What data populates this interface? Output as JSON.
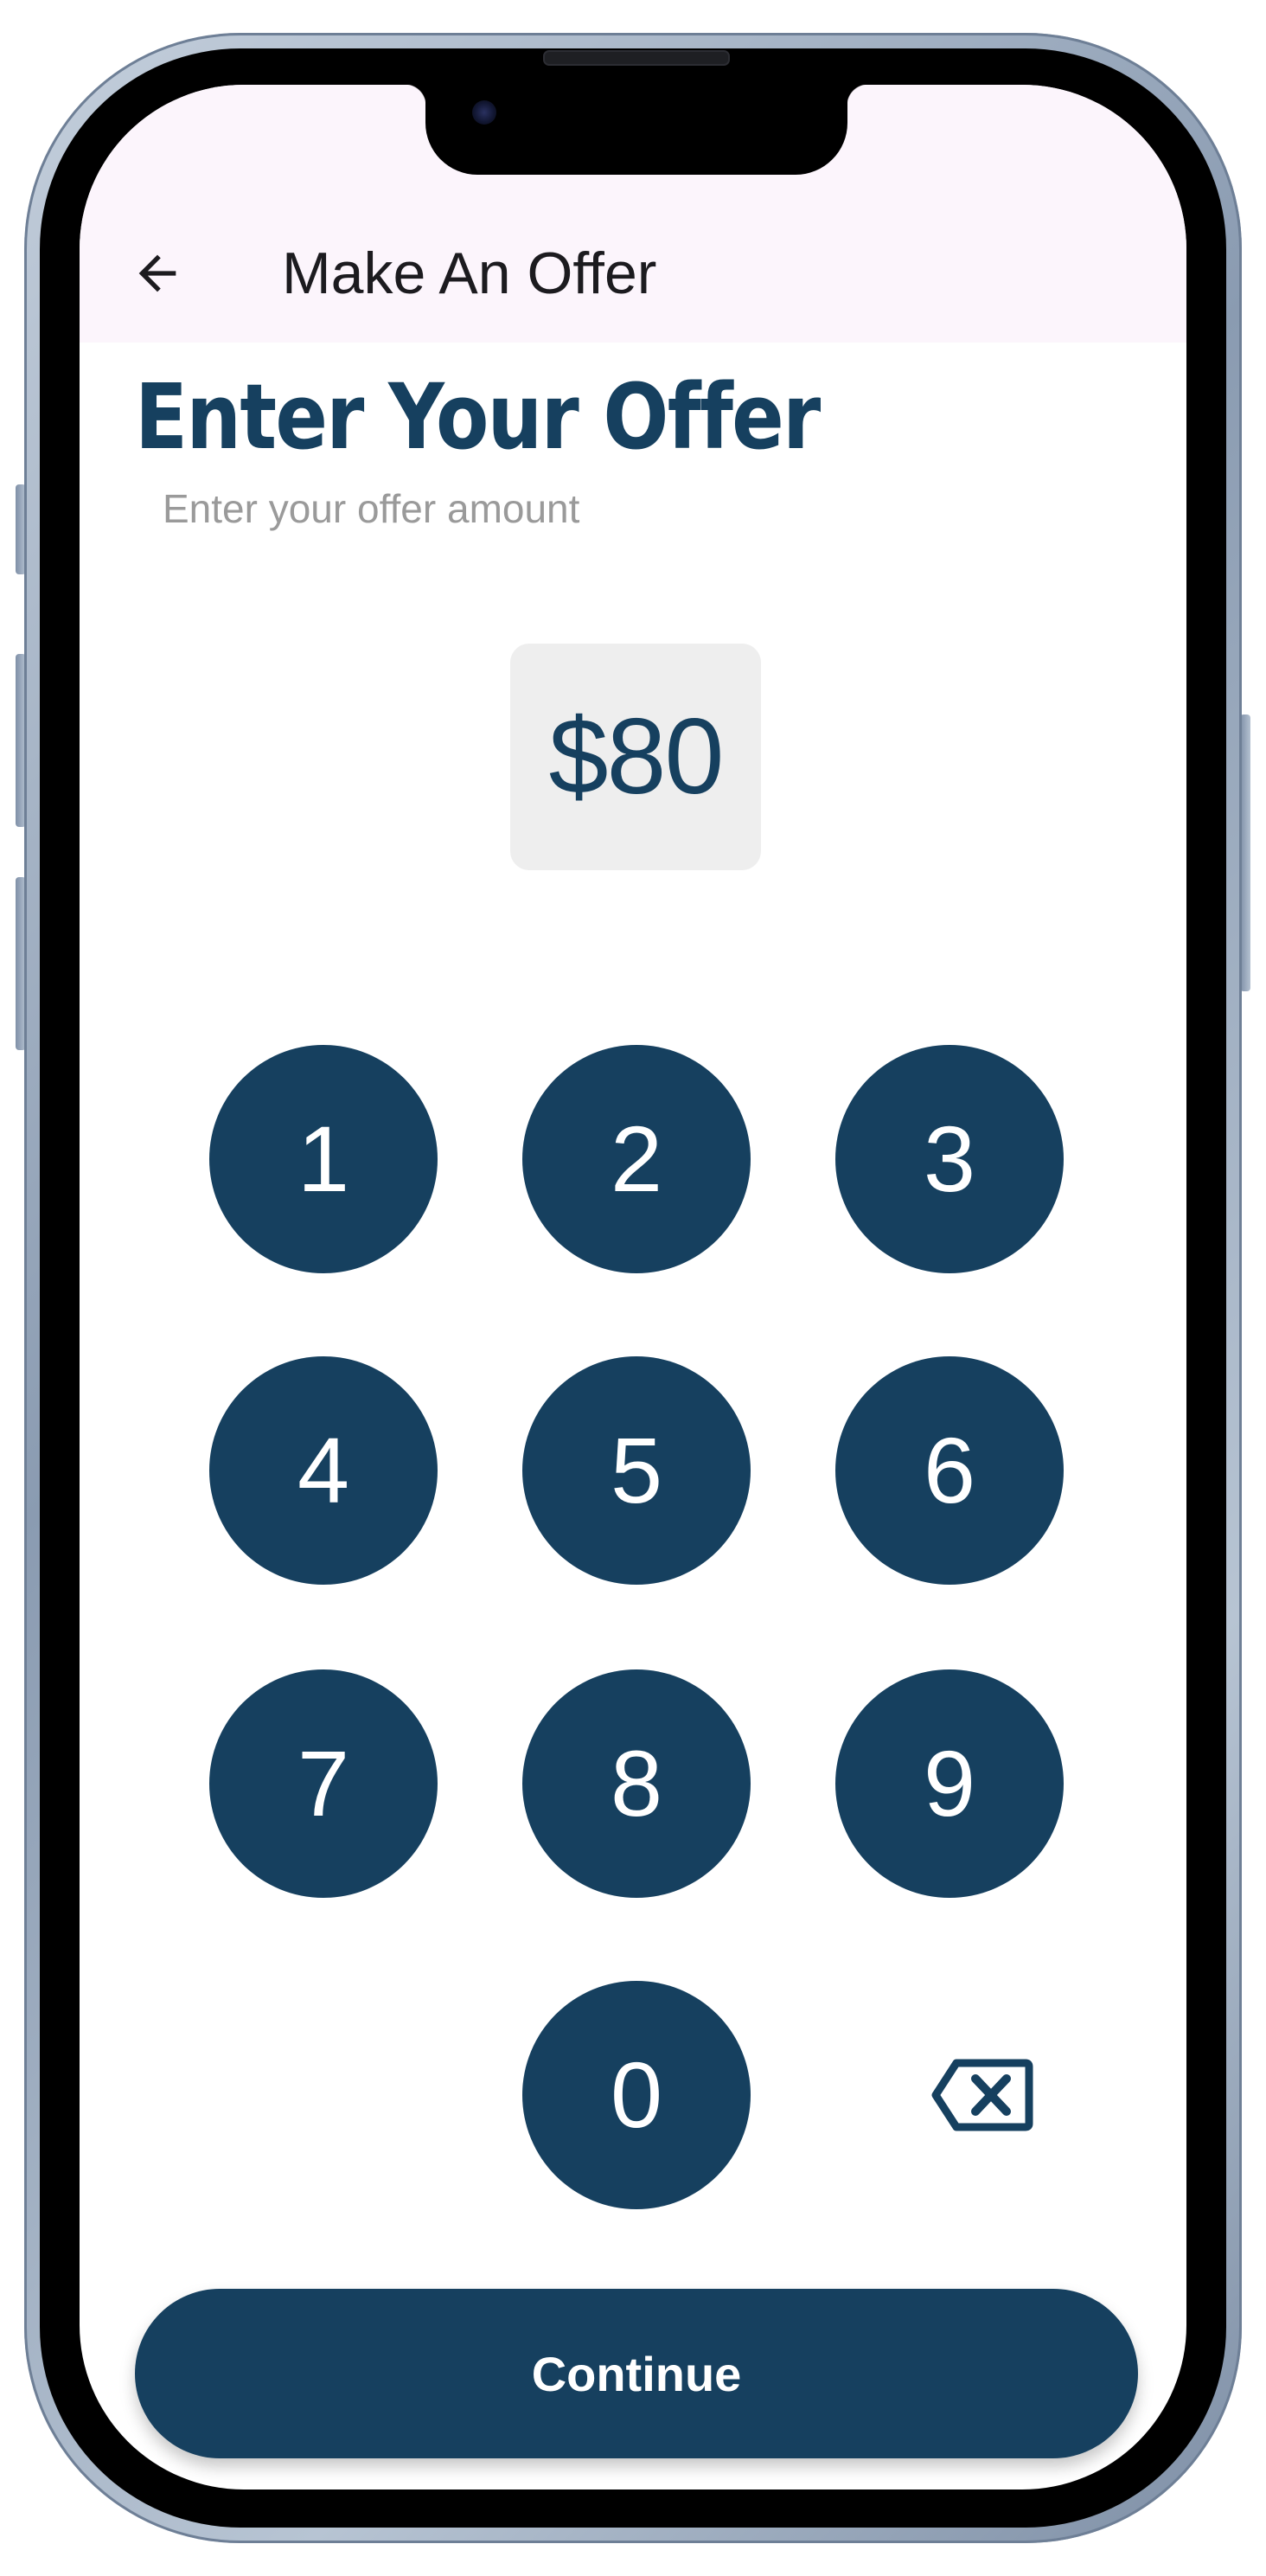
{
  "app_bar": {
    "title": "Make An Offer",
    "back_icon": "arrow-left-icon",
    "background": "#fcf5fc"
  },
  "offer": {
    "heading": "Enter Your Offer",
    "subheading": "Enter your offer amount",
    "amount": "$80"
  },
  "keypad": {
    "keys": [
      "1",
      "2",
      "3",
      "4",
      "5",
      "6",
      "7",
      "8",
      "9",
      "0"
    ],
    "backspace_icon": "backspace-icon"
  },
  "actions": {
    "continue_label": "Continue"
  },
  "colors": {
    "primary": "#16405f",
    "amount_box": "#eeeeee",
    "subheading": "#9a9a9a"
  }
}
